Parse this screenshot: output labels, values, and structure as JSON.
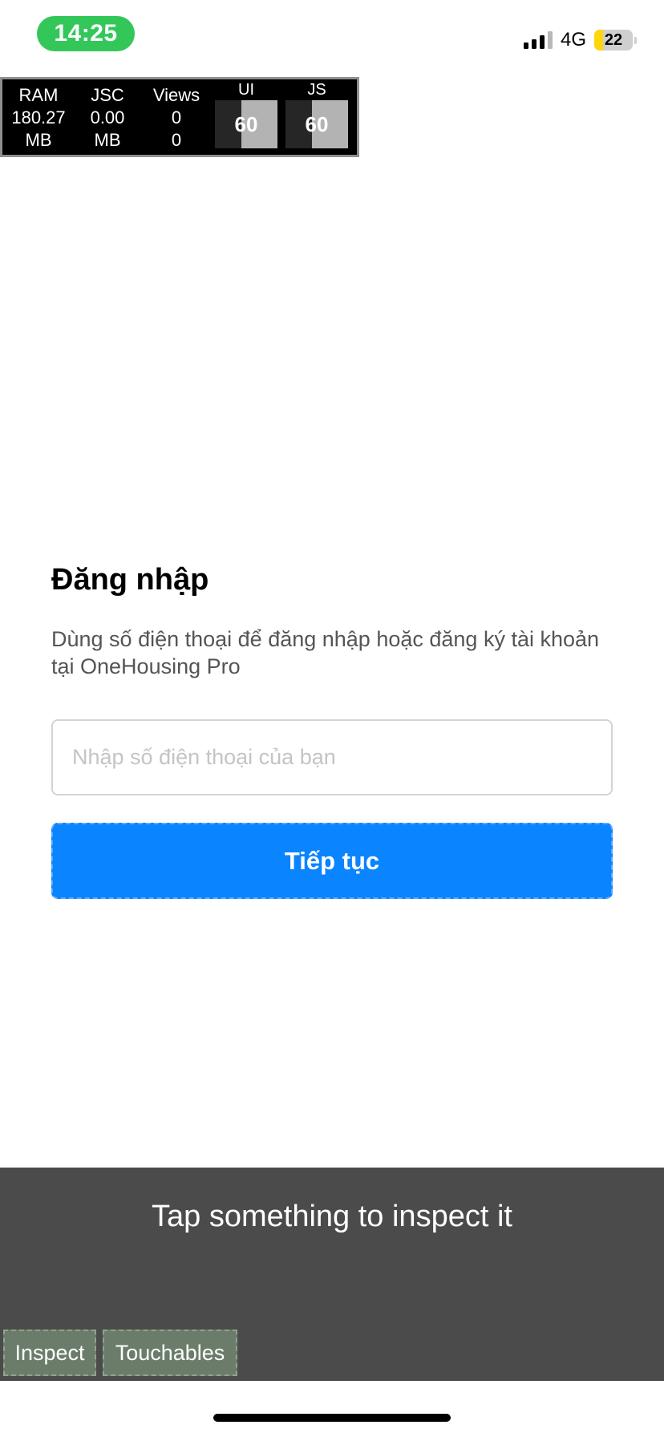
{
  "status_bar": {
    "time": "14:25",
    "network": "4G",
    "battery_level": "22",
    "battery_fraction": 0.22,
    "colors": {
      "time_pill": "#33c759",
      "battery_fill": "#ffd60a"
    }
  },
  "perf_monitor": {
    "ram": {
      "label": "RAM",
      "value": "180.27",
      "unit": "MB"
    },
    "jsc": {
      "label": "JSC",
      "value": "0.00",
      "unit": "MB"
    },
    "views": {
      "label": "Views",
      "value": "0",
      "secondary": "0"
    },
    "ui": {
      "label": "UI",
      "fps": "60"
    },
    "js": {
      "label": "JS",
      "fps": "60"
    }
  },
  "login": {
    "title": "Đăng nhập",
    "description": "Dùng số điện thoại để đăng nhập hoặc đăng ký tài khoản tại OneHousing Pro",
    "phone_placeholder": "Nhập số điện thoại của bạn",
    "phone_value": "",
    "continue_label": "Tiếp tục",
    "accent_color": "#0a84ff"
  },
  "inspector": {
    "hint": "Tap something to inspect it",
    "inspect_label": "Inspect",
    "touchables_label": "Touchables"
  }
}
